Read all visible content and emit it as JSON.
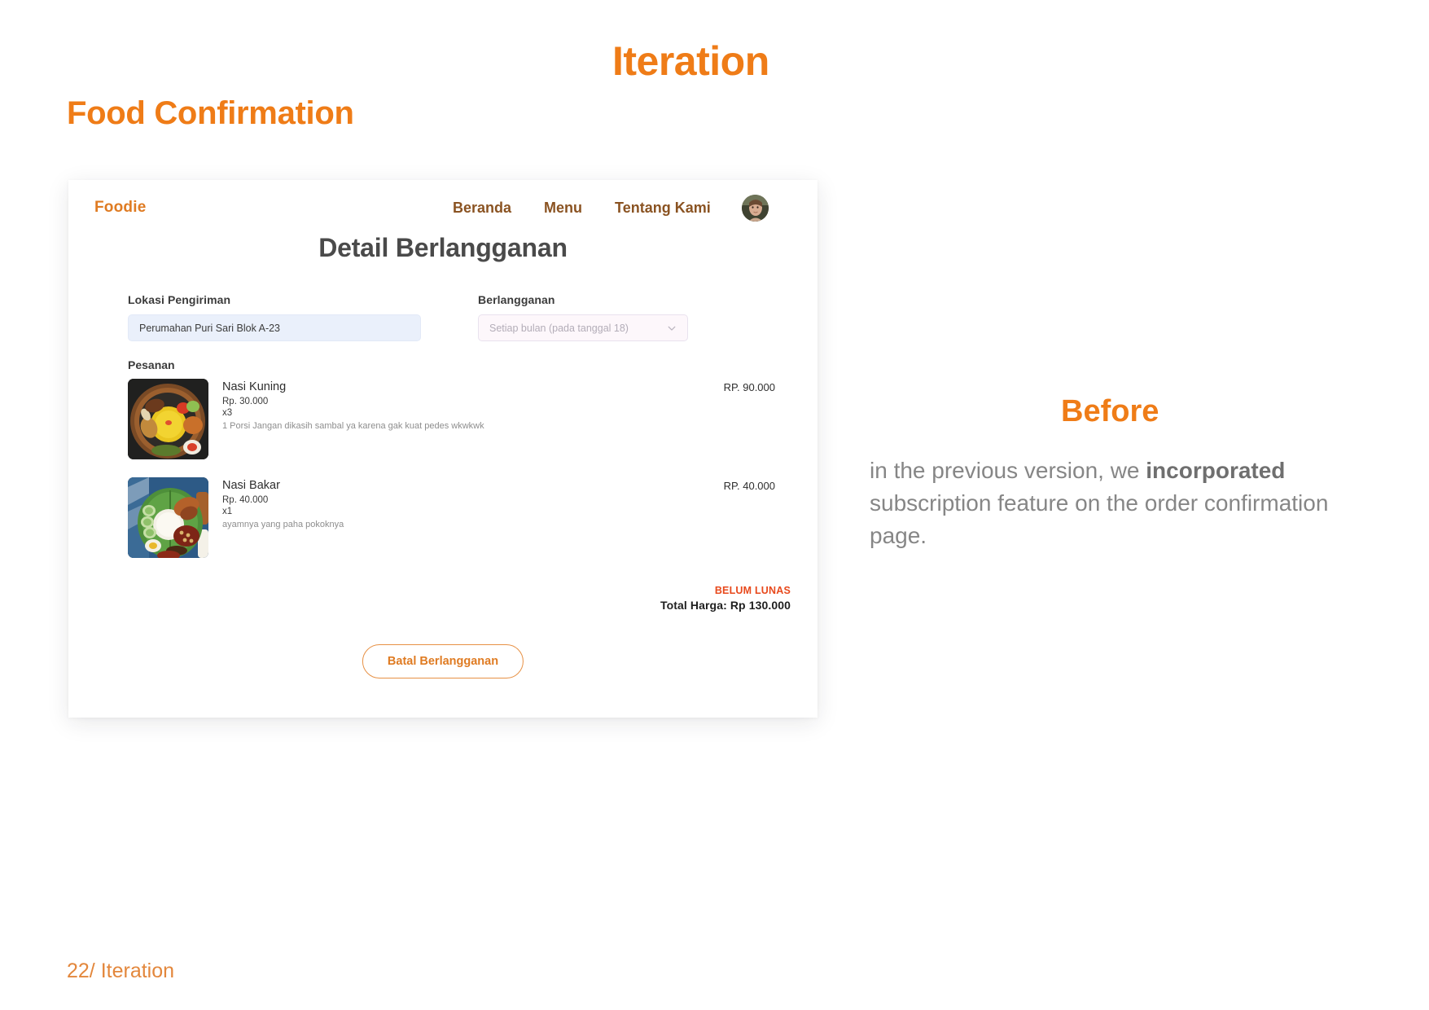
{
  "slide": {
    "title": "Iteration",
    "section_title": "Food Confirmation",
    "footer": "22/ Iteration"
  },
  "app": {
    "brand": "Foodie",
    "nav": [
      {
        "label": "Beranda"
      },
      {
        "label": "Menu"
      },
      {
        "label": "Tentang Kami"
      }
    ],
    "avatar_icon": "user-avatar-photo",
    "page_title": "Detail Berlangganan",
    "fields": {
      "location_label": "Lokasi Pengiriman",
      "location_value": "Perumahan Puri Sari Blok A-23",
      "subscription_label": "Berlangganan",
      "subscription_placeholder": "Setiap bulan (pada tanggal 18)",
      "chevron_icon": "chevron-down-icon"
    },
    "orders_label": "Pesanan",
    "orders": [
      {
        "image_icon": "nasi-kuning-photo",
        "name": "Nasi Kuning",
        "unit_price": "Rp. 30.000",
        "qty": "x3",
        "note": "1 Porsi Jangan dikasih sambal ya karena gak kuat pedes wkwkwk",
        "line_total": "RP. 90.000"
      },
      {
        "image_icon": "nasi-bakar-photo",
        "name": "Nasi Bakar",
        "unit_price": "Rp. 40.000",
        "qty": "x1",
        "note": "ayamnya yang paha pokoknya",
        "line_total": "RP. 40.000"
      }
    ],
    "payment_status": "BELUM LUNAS",
    "grand_total": "Total Harga: Rp 130.000",
    "cancel_button": "Batal Berlangganan"
  },
  "annotation": {
    "heading": "Before",
    "body_prefix": "in the previous version, we ",
    "body_bold": "incorporated",
    "body_suffix": " subscription feature on the order confirmation page."
  },
  "colors": {
    "accent_orange": "#ef7c17",
    "brand_orange": "#df7b22",
    "nav_brown": "#8a5322",
    "status_red": "#e8491c",
    "body_gray": "#868686"
  }
}
